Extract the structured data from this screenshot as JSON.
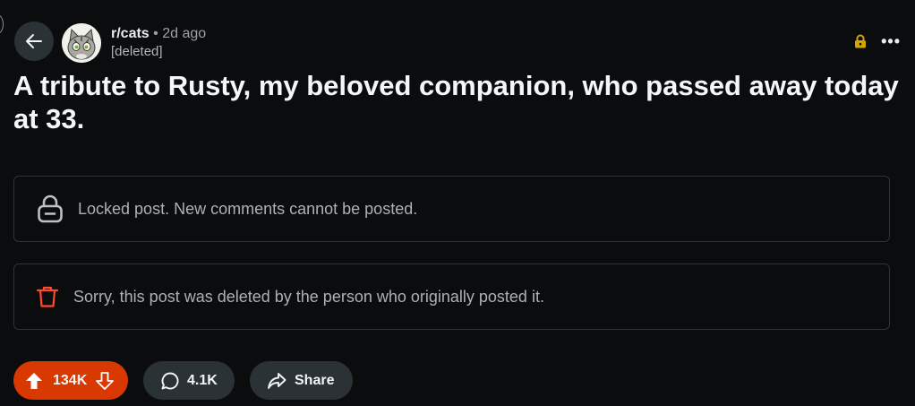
{
  "header": {
    "subreddit": "r/cats",
    "separator": "•",
    "time_ago": "2d ago",
    "author": "[deleted]",
    "back_icon": "arrow-left-icon",
    "lock_icon": "lock-icon",
    "more_icon": "more-horizontal-icon",
    "more_label": "•••"
  },
  "post": {
    "title": "A tribute to Rusty, my beloved companion, who passed away today at 33."
  },
  "notices": {
    "locked": {
      "icon": "lock-icon",
      "text": "Locked post. New comments cannot be posted."
    },
    "deleted": {
      "icon": "trash-icon",
      "text": "Sorry, this post was deleted by the person who originally posted it."
    }
  },
  "actions": {
    "vote_count": "134K",
    "comment_count": "4.1K",
    "share_label": "Share"
  },
  "colors": {
    "background": "#0b0c0d",
    "vote_accent": "#d93900",
    "lock_accent": "#d4a500",
    "trash_accent": "#ff4a2e",
    "pill_bg": "#2a3236"
  }
}
